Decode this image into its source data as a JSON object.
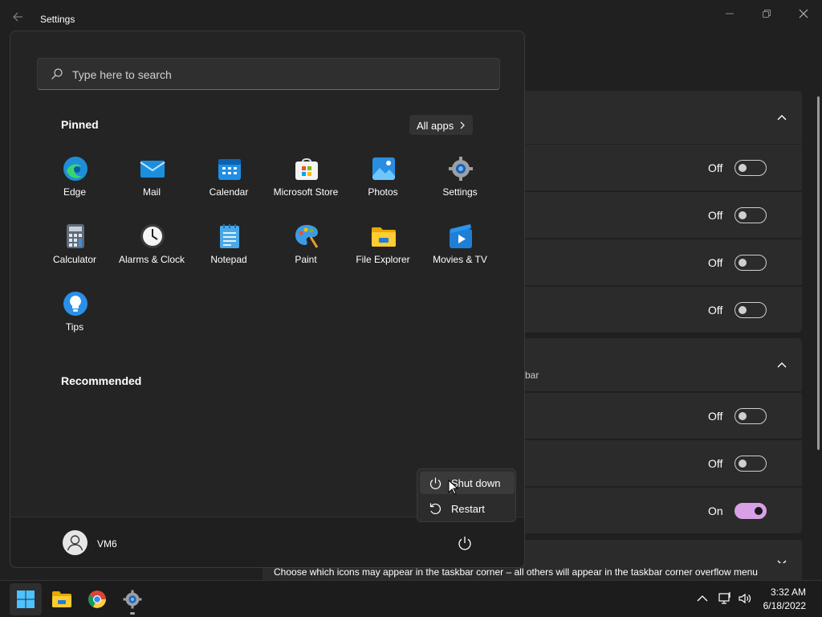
{
  "window": {
    "title": "Settings"
  },
  "settings_panel": {
    "group2_fragment": "bar",
    "rows": [
      {
        "state": "Off",
        "on": false
      },
      {
        "state": "Off",
        "on": false
      },
      {
        "state": "Off",
        "on": false
      },
      {
        "state": "Off",
        "on": false
      },
      {
        "state": "Off",
        "on": false
      },
      {
        "state": "Off",
        "on": false
      },
      {
        "state": "On",
        "on": true
      }
    ],
    "corner_overflow_description": "Choose which icons may appear in the taskbar corner – all others will appear in the taskbar corner overflow menu"
  },
  "start_menu": {
    "search_placeholder": "Type here to search",
    "pinned_title": "Pinned",
    "all_apps_label": "All apps",
    "recommended_title": "Recommended",
    "pinned_apps": [
      {
        "label": "Edge",
        "icon": "edge-icon"
      },
      {
        "label": "Mail",
        "icon": "mail-icon"
      },
      {
        "label": "Calendar",
        "icon": "calendar-icon"
      },
      {
        "label": "Microsoft Store",
        "icon": "store-icon"
      },
      {
        "label": "Photos",
        "icon": "photos-icon"
      },
      {
        "label": "Settings",
        "icon": "settings-gear-icon"
      },
      {
        "label": "Calculator",
        "icon": "calculator-icon"
      },
      {
        "label": "Alarms & Clock",
        "icon": "clock-icon"
      },
      {
        "label": "Notepad",
        "icon": "notepad-icon"
      },
      {
        "label": "Paint",
        "icon": "paint-icon"
      },
      {
        "label": "File Explorer",
        "icon": "folder-icon"
      },
      {
        "label": "Movies & TV",
        "icon": "movies-icon"
      },
      {
        "label": "Tips",
        "icon": "tips-bulb-icon"
      }
    ],
    "user_name": "VM6",
    "power_menu": {
      "shut_down": "Shut down",
      "restart": "Restart"
    }
  },
  "taskbar": {
    "apps": [
      "start-windows-icon",
      "file-explorer-icon",
      "chrome-icon",
      "settings-gear-icon"
    ],
    "tray_icons": [
      "chevron-up-icon",
      "network-icon",
      "volume-icon"
    ],
    "time": "3:32 AM",
    "date": "6/18/2022"
  },
  "colors": {
    "toggle_on": "#d8a0e6",
    "background": "#202020",
    "start_menu_bg": "#242424",
    "accent_blue": "#0078d4"
  }
}
